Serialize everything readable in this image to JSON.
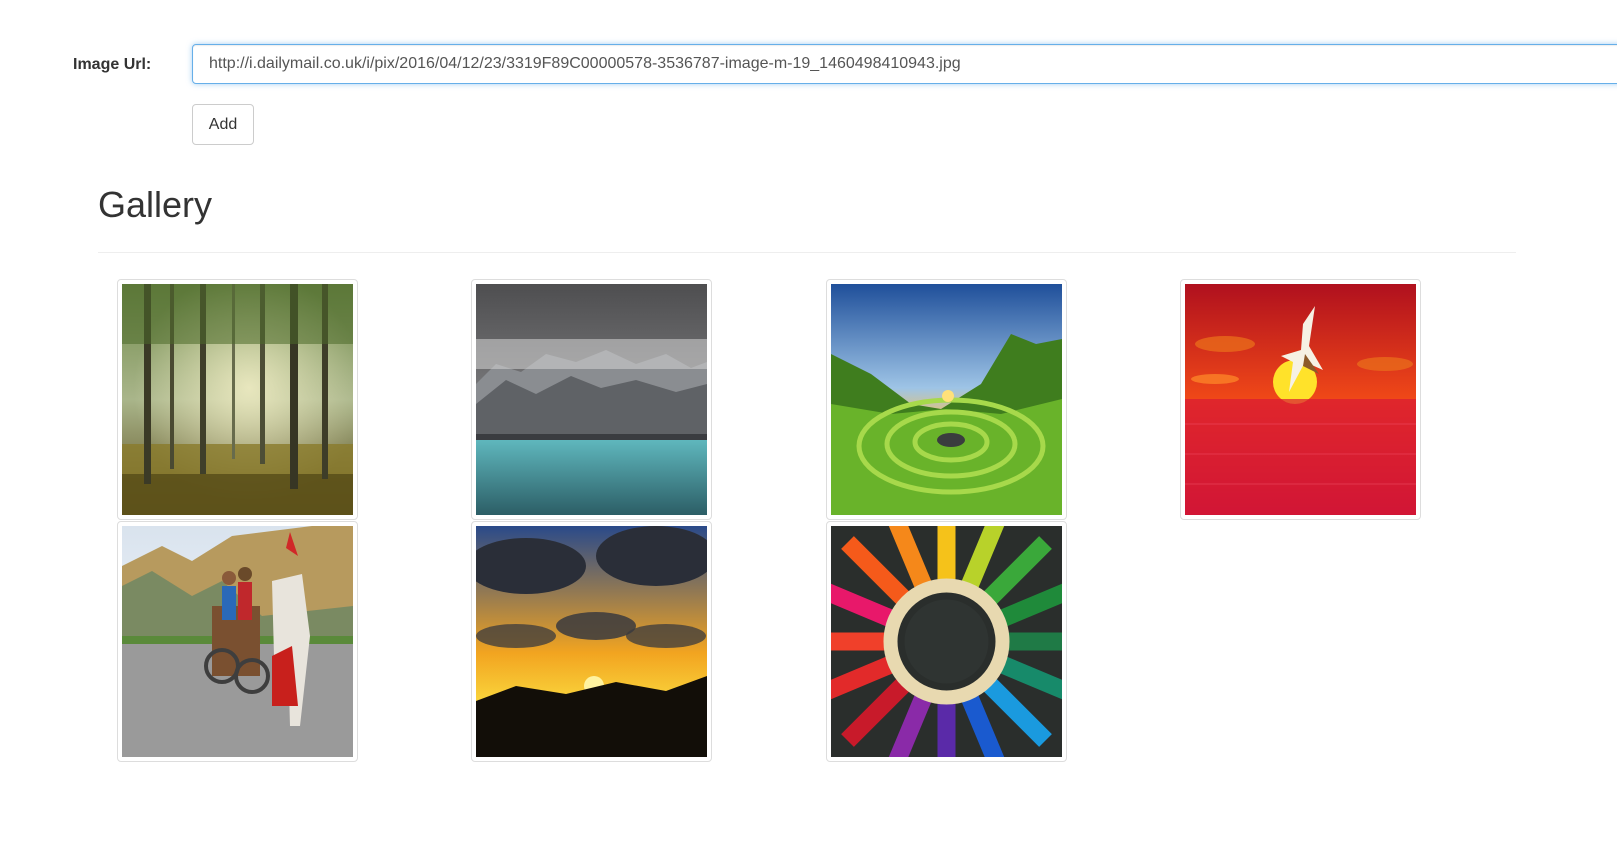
{
  "form": {
    "url_label": "Image Url:",
    "url_value": "http://i.dailymail.co.uk/i/pix/2016/04/12/23/3319F89C00000578-3536787-image-m-19_1460498410943.jpg",
    "add_label": "Add"
  },
  "gallery": {
    "title": "Gallery",
    "images": [
      {
        "subject": "sunlit forest with tall trees"
      },
      {
        "subject": "misty cliffs above turquoise lake"
      },
      {
        "subject": "green valley with stone spiral under sunset sky"
      },
      {
        "subject": "seagull flying across red sunset over water"
      },
      {
        "subject": "horse-drawn cart with riders on mountain road"
      },
      {
        "subject": "golden sunset through dark clouds"
      },
      {
        "subject": "colored pencils arranged in a circle"
      }
    ]
  }
}
